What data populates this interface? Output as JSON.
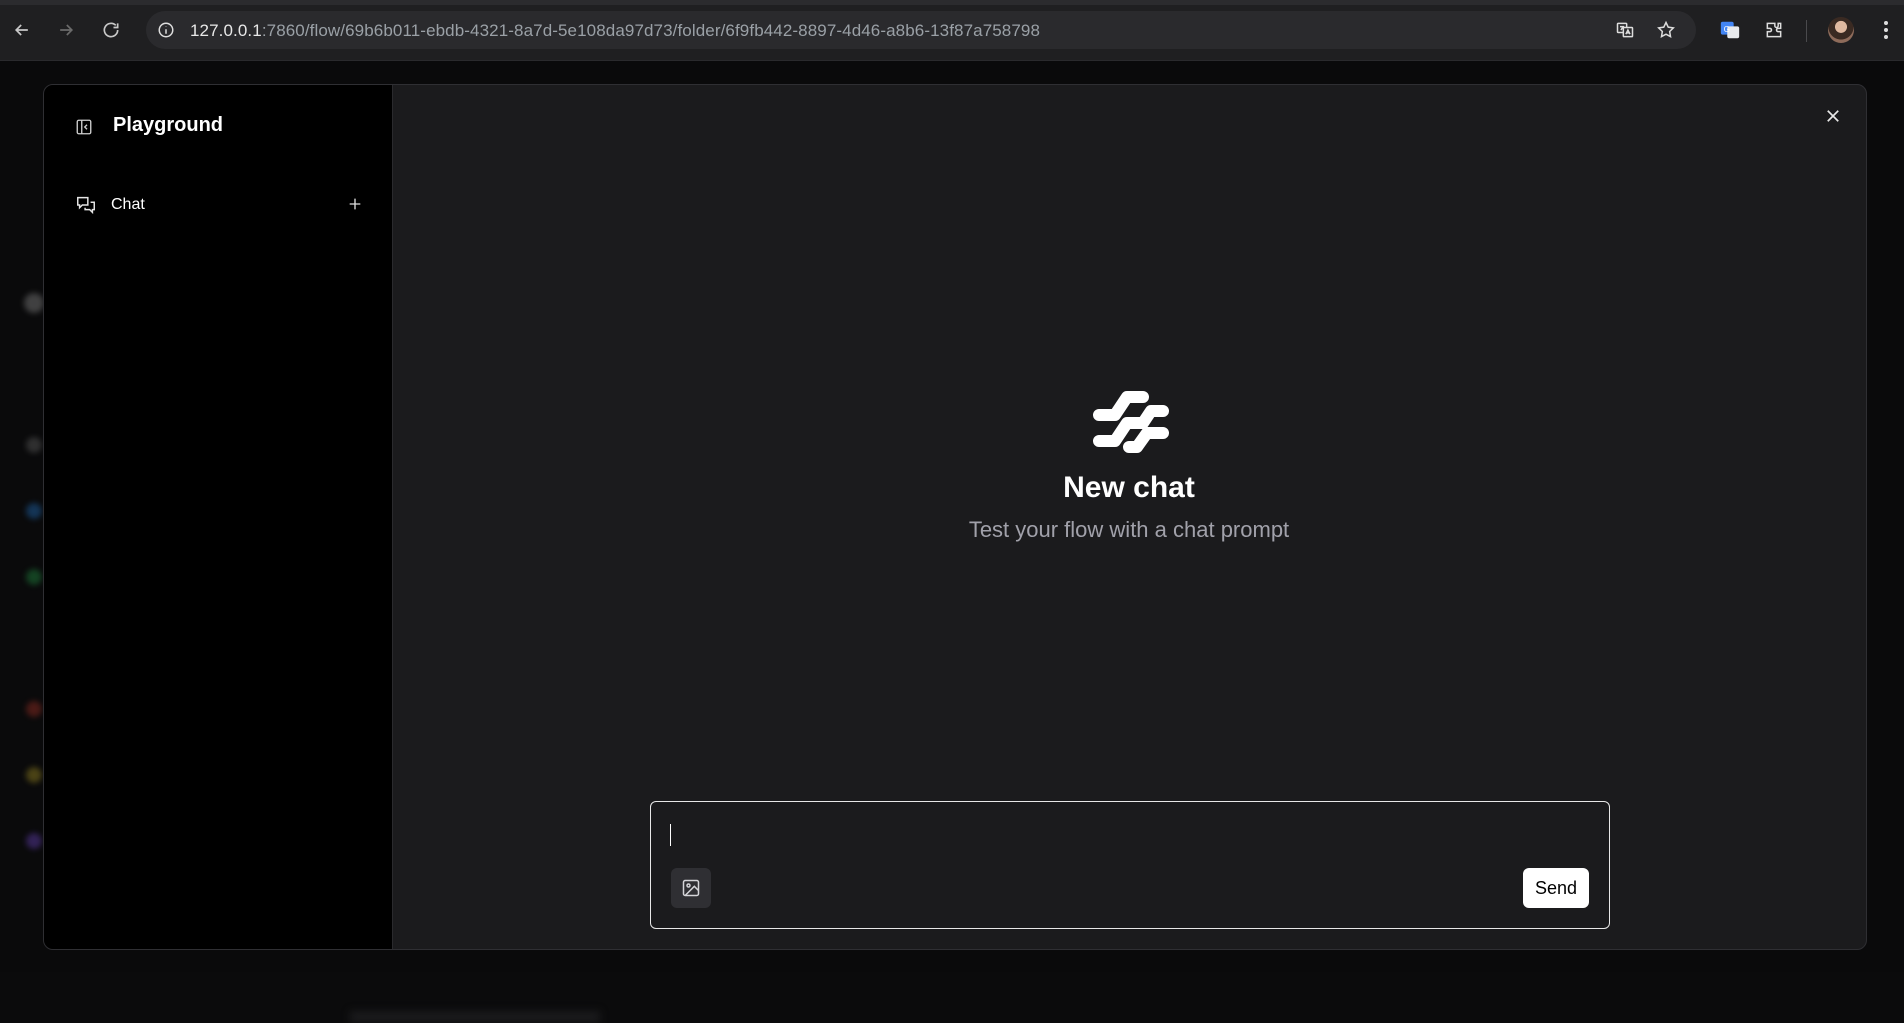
{
  "browser": {
    "url_host": "127.0.0.1",
    "url_rest": ":7860/flow/69b6b011-ebdb-4321-8a7d-5e108da97d73/folder/6f9fb442-8897-4d46-a8b6-13f87a758798"
  },
  "sidebar": {
    "title": "Playground",
    "items": [
      {
        "label": "Chat"
      }
    ]
  },
  "empty_state": {
    "title": "New chat",
    "subtitle": "Test your flow with a chat prompt"
  },
  "composer": {
    "value": "",
    "send_label": "Send"
  },
  "colors": {
    "background": "#1b1b1d",
    "sidebar": "#000000",
    "accent_button": "#ffffff"
  }
}
